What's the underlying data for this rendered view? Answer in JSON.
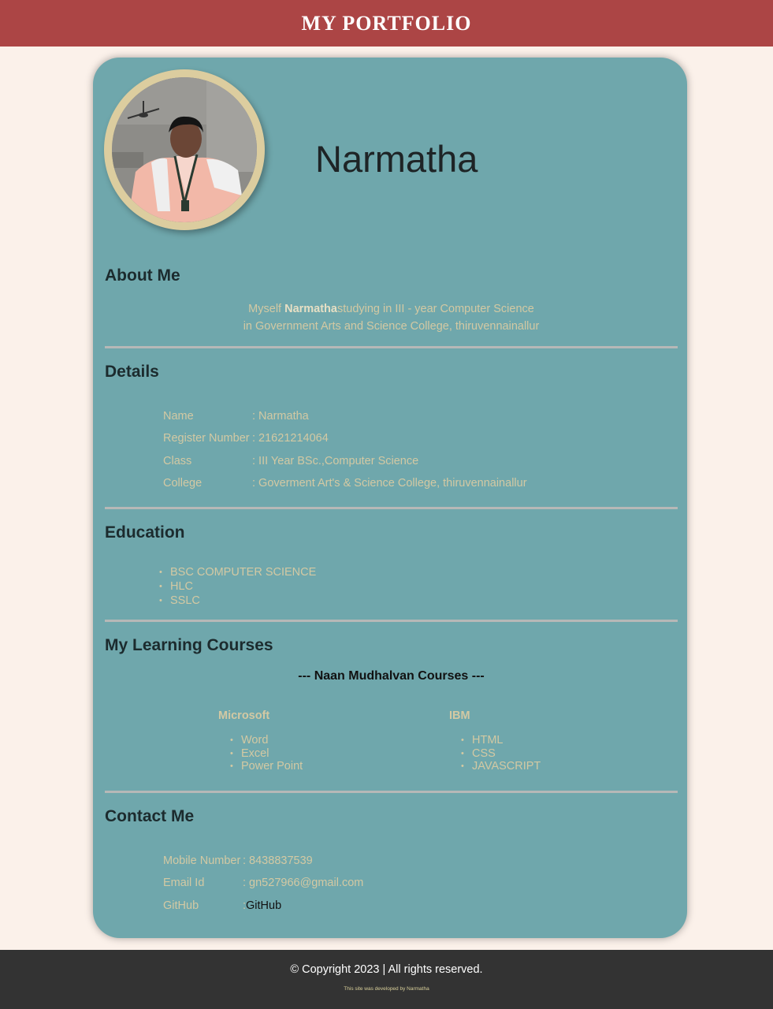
{
  "header": {
    "title": "MY PORTFOLIO"
  },
  "profile": {
    "name": "Narmatha",
    "photo_alt": "profile-photo"
  },
  "about": {
    "title": "About Me",
    "line1_prefix": "Myself ",
    "line1_name": "Narmatha",
    "line1_suffix": "studying in III - year Computer Science",
    "line2": "in Government Arts and Science College, thiruvennainallur"
  },
  "details": {
    "title": "Details",
    "rows": [
      {
        "label": "Name",
        "value": ": Narmatha"
      },
      {
        "label": "Register Number",
        "value": ": 21621214064"
      },
      {
        "label": "Class",
        "value": ": III Year BSc.,Computer Science"
      },
      {
        "label": "College",
        "value": ": Goverment Art's & Science College, thiruvennainallur"
      }
    ]
  },
  "education": {
    "title": "Education",
    "items": [
      "BSC COMPUTER SCIENCE",
      "HLC",
      "SSLC"
    ]
  },
  "courses": {
    "title": "My Learning Courses",
    "subtitle": "--- Naan Mudhalvan Courses ---",
    "providers": [
      {
        "name": "Microsoft",
        "items": [
          "Word",
          "Excel",
          "Power Point"
        ]
      },
      {
        "name": "IBM",
        "items": [
          "HTML",
          "CSS",
          "JAVASCRIPT"
        ]
      }
    ]
  },
  "contact": {
    "title": "Contact Me",
    "rows": [
      {
        "label": "Mobile Number",
        "value": ": 8438837539"
      },
      {
        "label": "Email Id",
        "value": ": gn527966@gmail.com"
      },
      {
        "label": "GitHub",
        "sep": ": ",
        "link": "GitHub"
      }
    ]
  },
  "footer": {
    "copyright": "© Copyright 2023 | All rights reserved.",
    "developed_by": "This site was developed by Narmatha"
  },
  "colors": {
    "header_bg": "#ac4545",
    "page_bg": "#fbf1ea",
    "card_bg": "#6fa7ac",
    "text_muted": "#d3c9a3",
    "footer_bg": "#333333"
  }
}
